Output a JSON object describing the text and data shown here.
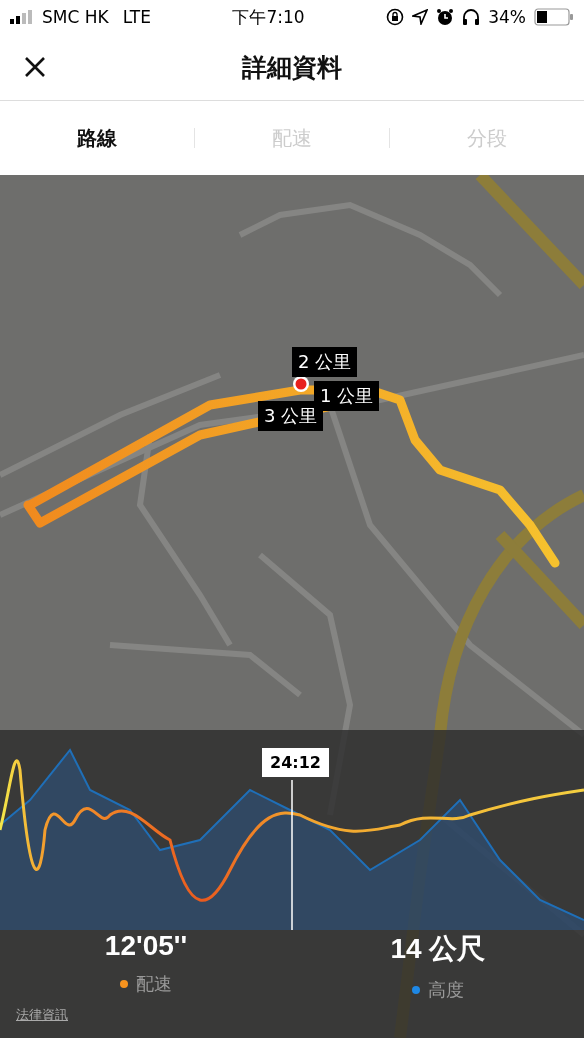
{
  "status_bar": {
    "carrier": "SMC HK",
    "network": "LTE",
    "time": "下午7:10",
    "battery": "34%"
  },
  "header": {
    "title": "詳細資料"
  },
  "tabs": [
    {
      "label": "路線",
      "selected": true
    },
    {
      "label": "配速",
      "selected": false
    },
    {
      "label": "分段",
      "selected": false
    }
  ],
  "map": {
    "distance_markers": [
      "3 公里",
      "2 公里",
      "1 公里"
    ]
  },
  "chart": {
    "cursor_time": "24:12"
  },
  "stats": [
    {
      "value": "12'05''",
      "label": "配速",
      "color": "#f7931e"
    },
    {
      "value": "14 公尺",
      "label": "高度",
      "color": "#1e88e5"
    }
  ],
  "legal_link": "法律資訊"
}
